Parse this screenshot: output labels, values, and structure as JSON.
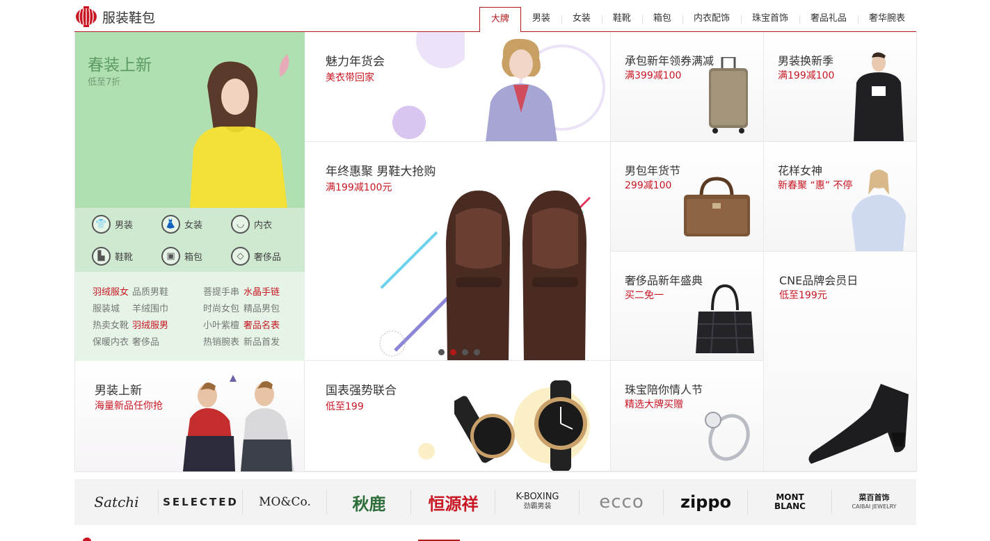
{
  "header": {
    "logo_text": "服装鞋包",
    "tabs": [
      "大牌",
      "男装",
      "女装",
      "鞋靴",
      "箱包",
      "内衣配饰",
      "珠宝首饰",
      "奢品礼品",
      "奢华腕表"
    ],
    "active_tab": "大牌"
  },
  "left": {
    "hero_title": "春装上新",
    "hero_sub": "低至7折",
    "categories": [
      {
        "label": "男装",
        "icon": "tshirt-icon"
      },
      {
        "label": "女装",
        "icon": "dress-icon"
      },
      {
        "label": "内衣",
        "icon": "lingerie-icon"
      },
      {
        "label": "鞋靴",
        "icon": "boot-icon"
      },
      {
        "label": "箱包",
        "icon": "bag-icon"
      },
      {
        "label": "奢侈品",
        "icon": "diamond-icon"
      }
    ],
    "links": [
      {
        "text": "羽绒服女",
        "red": true
      },
      {
        "text": "品质男鞋",
        "red": false
      },
      {
        "text": "菩提手串",
        "red": false
      },
      {
        "text": "水晶手链",
        "red": true
      },
      {
        "text": "服装城",
        "red": false
      },
      {
        "text": "羊绒围巾",
        "red": false
      },
      {
        "text": "时尚女包",
        "red": false
      },
      {
        "text": "精品男包",
        "red": false
      },
      {
        "text": "热卖女靴",
        "red": false
      },
      {
        "text": "羽绒服男",
        "red": true
      },
      {
        "text": "小叶紫檀",
        "red": false
      },
      {
        "text": "奢品名表",
        "red": true
      },
      {
        "text": "保暖内衣",
        "red": false
      },
      {
        "text": "奢侈品",
        "red": false
      },
      {
        "text": "热销腕表",
        "red": false
      },
      {
        "text": "新品首发",
        "red": false
      }
    ],
    "bottom_title": "男装上新",
    "bottom_sub": "海量新品任你抢"
  },
  "tiles": {
    "t1": {
      "title": "魅力年货会",
      "sub": "美衣带回家"
    },
    "t2": {
      "title": "年终惠聚 男鞋大抢购",
      "sub": "满199减100元"
    },
    "t3": {
      "title": "国表强势联合",
      "sub": "低至199"
    },
    "t4": {
      "title": "承包新年领券满减",
      "sub": "满399减100"
    },
    "t5": {
      "title": "男装换新季",
      "sub": "满199减100"
    },
    "t6": {
      "title": "男包年货节",
      "sub": "299减100"
    },
    "t7": {
      "title": "花样女神",
      "sub": "新春聚 “惠” 不停"
    },
    "t8": {
      "title": "奢侈品新年盛典",
      "sub": "买二免一"
    },
    "t9": {
      "title": "CNE品牌会员日",
      "sub": "低至199元"
    },
    "t10": {
      "title": "珠宝陪你情人节",
      "sub": "精选大牌买赠"
    }
  },
  "carousel": {
    "count": 4,
    "active": 1
  },
  "brands": [
    "Satchi",
    "SELECTED",
    "MO&Co.",
    "秋鹿",
    "恒源祥",
    "K-BOXING",
    "ecco",
    "zippo",
    "MONT BLANC",
    "CAIBAI JEWELRY"
  ],
  "brand_sub": {
    "kboxing": "劲霸男装",
    "caibai": "菜百首饰"
  },
  "colors": {
    "accent": "#b1191a",
    "price_red": "#c81623",
    "hero_green": "#b0dfb2"
  }
}
